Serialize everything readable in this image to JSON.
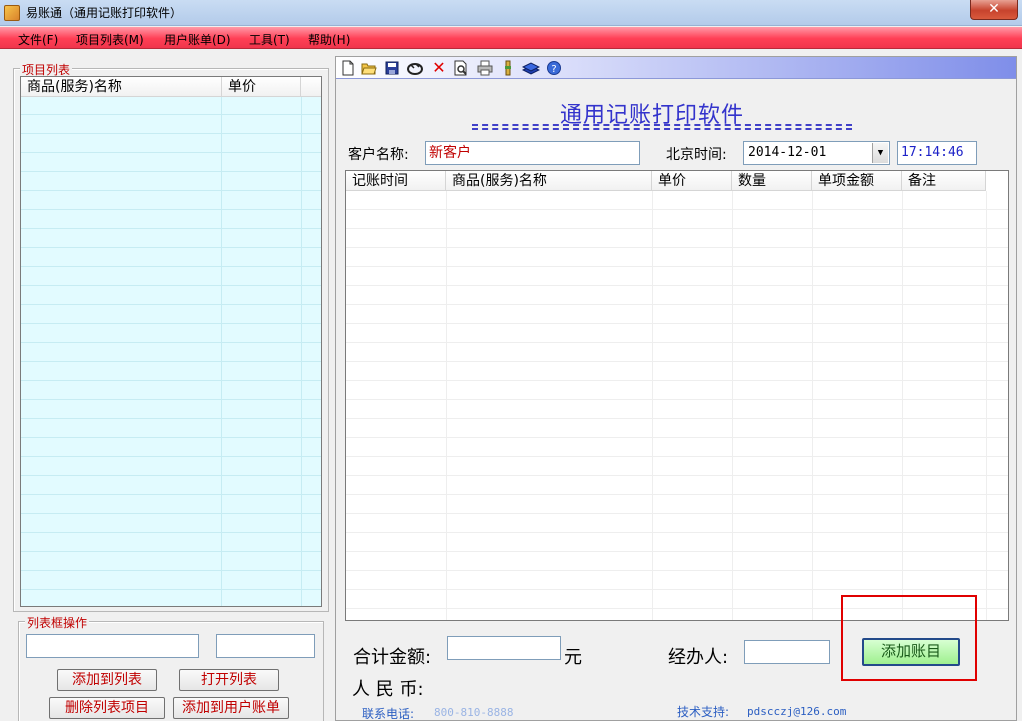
{
  "window": {
    "title": "易账通（通用记账打印软件）",
    "close_glyph": "✕"
  },
  "menu": [
    "文件(F)",
    "项目列表(M)",
    "用户账单(D)",
    "工具(T)",
    "帮助(H)"
  ],
  "left": {
    "item_list_group": "项目列表",
    "item_list_columns": [
      "商品(服务)名称",
      "单价"
    ],
    "list_ops_group": "列表框操作",
    "input_name_value": "",
    "input_price_value": "",
    "buttons": {
      "add_to_list": "添加到列表",
      "open_list": "打开列表",
      "delete_item": "删除列表项目",
      "add_to_bill": "添加到用户账单"
    }
  },
  "toolbar": {
    "icons": [
      "new-file-icon",
      "open-folder-icon",
      "save-icon",
      "edit-icon",
      "delete-icon",
      "print-preview-icon",
      "print-icon",
      "tool-icon",
      "books-icon",
      "help-icon"
    ]
  },
  "main": {
    "title": "通用记账打印软件",
    "customer_label": "客户名称:",
    "customer_value": "新客户",
    "time_label": "北京时间:",
    "date_value": "2014-12-01",
    "time_value": "17:14:46",
    "grid_columns": [
      "记账时间",
      "商品(服务)名称",
      "单价",
      "数量",
      "单项金额",
      "备注"
    ],
    "total_label": "合计金额:",
    "total_value": "",
    "yuan_label": "元",
    "rmb_label": "人 民 币:",
    "handler_label": "经办人:",
    "handler_value": "",
    "add_entry_button": "添加账目",
    "contact_label": "联系电话:",
    "contact_value": "800-810-8888",
    "support_label": "技术支持:",
    "support_value": "pdscczj@126.com"
  },
  "colors": {
    "menubar": "#ff4a5e",
    "list_background": "#e2fbff",
    "title_blue": "#3333cc",
    "label_red": "#c00000",
    "highlight": "#e00000"
  }
}
